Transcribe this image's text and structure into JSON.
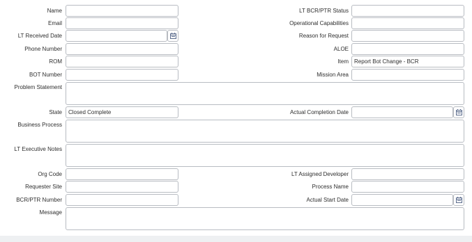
{
  "fields": {
    "name": {
      "label": "Name",
      "value": ""
    },
    "email": {
      "label": "Email",
      "value": ""
    },
    "lt_received_date": {
      "label": "LT Received Date",
      "value": ""
    },
    "phone_number": {
      "label": "Phone Number",
      "value": ""
    },
    "rom": {
      "label": "ROM",
      "value": ""
    },
    "bot_number": {
      "label": "BOT Number",
      "value": ""
    },
    "problem_statement": {
      "label": "Problem Statement",
      "value": ""
    },
    "state": {
      "label": "State",
      "value": "Closed Complete"
    },
    "business_process": {
      "label": "Business Process",
      "value": ""
    },
    "lt_executive_notes": {
      "label": "LT Executive Notes",
      "value": ""
    },
    "org_code": {
      "label": "Org Code",
      "value": ""
    },
    "requester_site": {
      "label": "Requester Site",
      "value": ""
    },
    "bcr_ptr_number": {
      "label": "BCR/PTR Number",
      "value": ""
    },
    "message": {
      "label": "Message",
      "value": ""
    },
    "lt_bcr_ptr_status": {
      "label": "LT BCR/PTR Status",
      "value": ""
    },
    "operational_capabilities": {
      "label": "Operational Capabilities",
      "value": ""
    },
    "reason_for_request": {
      "label": "Reason for Request",
      "value": ""
    },
    "aloe": {
      "label": "ALOE",
      "value": ""
    },
    "item": {
      "label": "Item",
      "value": "Report Bot Change - BCR"
    },
    "mission_area": {
      "label": "Mission Area",
      "value": ""
    },
    "actual_completion_date": {
      "label": "Actual Completion Date",
      "value": ""
    },
    "lt_assigned_developer": {
      "label": "LT Assigned Developer",
      "value": ""
    },
    "process_name": {
      "label": "Process Name",
      "value": ""
    },
    "actual_start_date": {
      "label": "Actual Start Date",
      "value": ""
    }
  },
  "icons": {
    "calendar": "calendar-icon"
  },
  "colors": {
    "border": "#b8bcc2",
    "footer": "#eef0f2",
    "text": "#2e2e2e"
  }
}
